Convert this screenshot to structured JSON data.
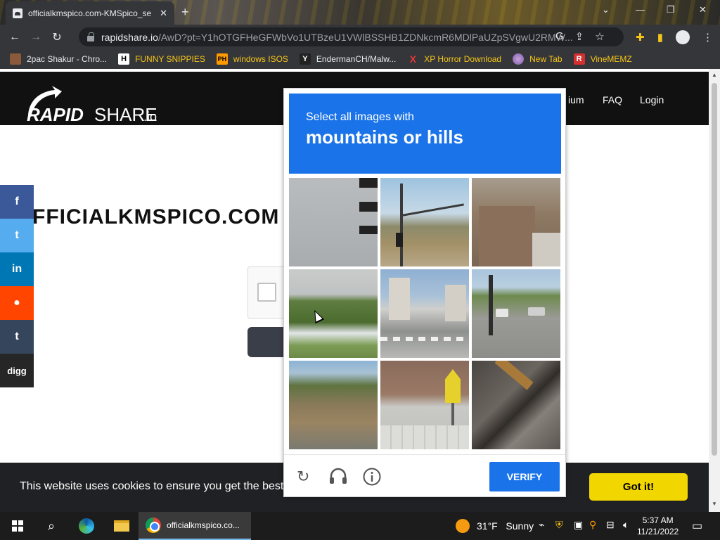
{
  "browser": {
    "tab_title": "officialkmspico.com-KMSpico_se",
    "tab_close": "✕",
    "new_tab": "+",
    "url_host": "rapidshare.io",
    "url_path": "/AwD?pt=Y1hOTGFHeGFWbVo1UTBzeU1VWlBSSHB1ZDNkcmR6MDlPaUZpSVgwU2RMW...",
    "window_controls": [
      "⌄",
      "—",
      "❐",
      "✕"
    ]
  },
  "bookmarks": [
    {
      "label": "2pac Shakur - Chro...",
      "icon": "2pac-icon"
    },
    {
      "label": "FUNNY SNIPPIES",
      "icon": "h-icon",
      "icon_text": "H"
    },
    {
      "label": "windows ISOS",
      "icon": "ph-icon",
      "icon_text": "PH"
    },
    {
      "label": "EndermanCH/Malw...",
      "icon": "yt-icon",
      "icon_text": "Y"
    },
    {
      "label": "XP Horror Download",
      "icon": "x-icon",
      "icon_text": "X"
    },
    {
      "label": "New Tab",
      "icon": "globe-icon"
    },
    {
      "label": "VineMEMZ",
      "icon": "r-icon",
      "icon_text": "R"
    }
  ],
  "site": {
    "logo_rapid": "RAPID",
    "logo_share": "SHARE",
    "logo_tld": ".io",
    "nav": [
      "ium",
      "FAQ",
      "Login"
    ],
    "heading": "FFICIALKMSPICO.COM"
  },
  "share_buttons": [
    {
      "label": "f",
      "name": "facebook-share-button",
      "color": "#3b5998"
    },
    {
      "label": "t",
      "name": "twitter-share-button",
      "color": "#55acee"
    },
    {
      "label": "in",
      "name": "linkedin-share-button",
      "color": "#0077b5"
    },
    {
      "label": "●",
      "name": "reddit-share-button",
      "color": "#ff4500"
    },
    {
      "label": "t",
      "name": "tumblr-share-button",
      "color": "#35465c"
    },
    {
      "label": "digg",
      "name": "digg-share-button",
      "color": "#262626"
    }
  ],
  "cookie": {
    "text": "This website uses cookies to ensure you get the best",
    "button": "Got it!"
  },
  "captcha": {
    "instruction": "Select all images with",
    "target": "mountains or hills",
    "verify": "VERIFY",
    "colors": {
      "header": "#1a73e8",
      "verify": "#1a73e8"
    }
  },
  "taskbar": {
    "chrome_label": "officialkmspico.co...",
    "temperature": "31°F",
    "weather": "Sunny",
    "time": "5:37 AM",
    "date": "11/21/2022"
  }
}
